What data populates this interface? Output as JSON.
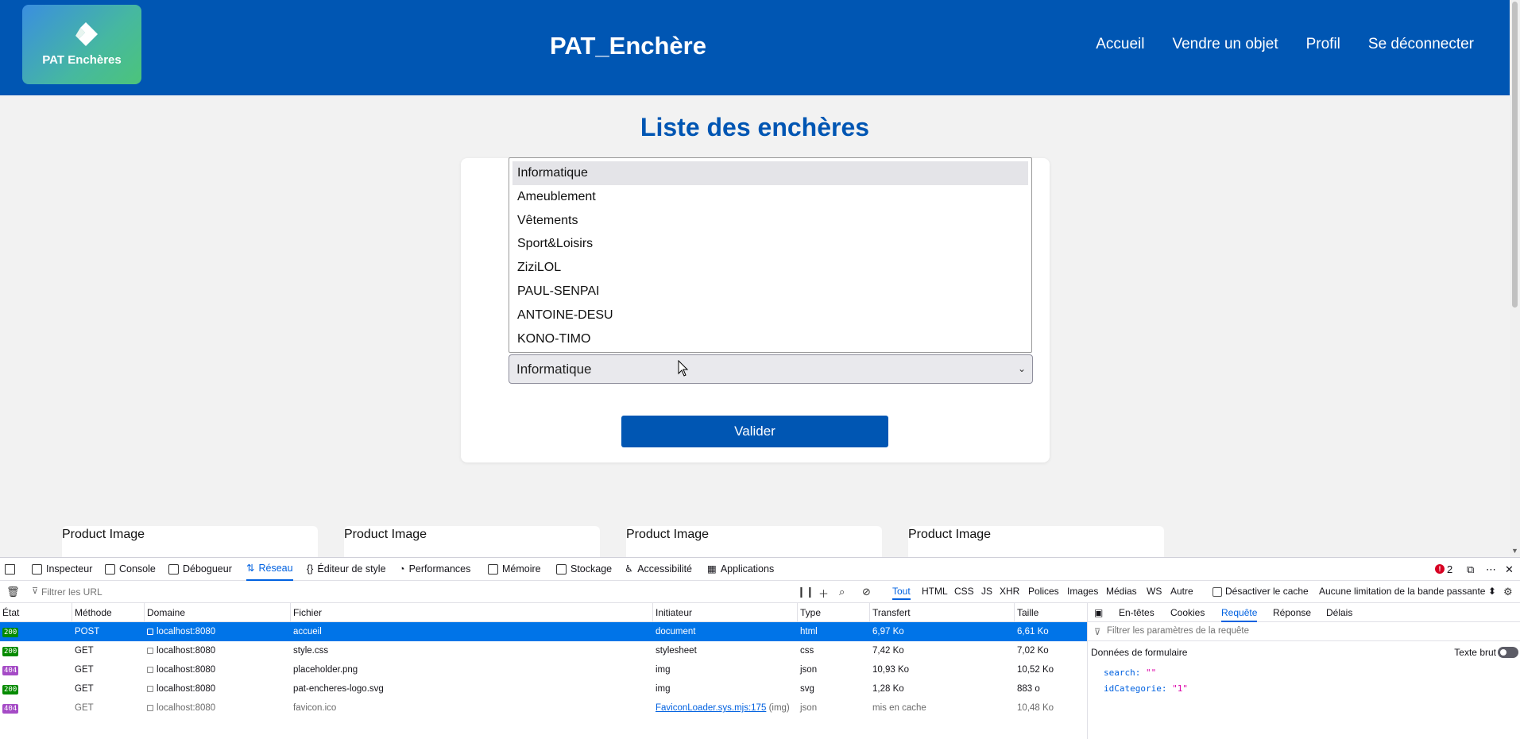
{
  "header": {
    "logo_text": "PAT Enchères",
    "title": "PAT_Enchère",
    "nav": [
      "Accueil",
      "Vendre un objet",
      "Profil",
      "Se déconnecter"
    ]
  },
  "main": {
    "heading": "Liste des enchères",
    "category_options": [
      "Informatique",
      "Ameublement",
      "Vêtements",
      "Sport&Loisirs",
      "ZiziLOL",
      "PAUL-SENPAI",
      "ANTOINE-DESU",
      "KONO-TIMO"
    ],
    "selected_category": "Informatique",
    "validate_label": "Valider",
    "product_cards": [
      "Product Image",
      "Product Image",
      "Product Image",
      "Product Image"
    ]
  },
  "devtools": {
    "tabs": [
      "Inspecteur",
      "Console",
      "Débogueur",
      "Réseau",
      "Éditeur de style",
      "Performances",
      "Mémoire",
      "Stockage",
      "Accessibilité",
      "Applications"
    ],
    "active_tab": "Réseau",
    "error_count": "2",
    "filter_placeholder": "Filtrer les URL",
    "type_filters": [
      "Tout",
      "HTML",
      "CSS",
      "JS",
      "XHR",
      "Polices",
      "Images",
      "Médias",
      "WS",
      "Autre"
    ],
    "disable_cache_label": "Désactiver le cache",
    "throttle_label": "Aucune limitation de la bande passante ⬍",
    "columns": [
      "État",
      "Méthode",
      "Domaine",
      "Fichier",
      "Initiateur",
      "Type",
      "Transfert",
      "Taille"
    ],
    "rows": [
      {
        "status": "200",
        "method": "POST",
        "domain": "localhost:8080",
        "file": "accueil",
        "initiator": "document",
        "initiator_extra": "",
        "type": "html",
        "transfer": "6,97 Ko",
        "size": "6,61 Ko"
      },
      {
        "status": "200",
        "method": "GET",
        "domain": "localhost:8080",
        "file": "style.css",
        "initiator": "stylesheet",
        "initiator_extra": "",
        "type": "css",
        "transfer": "7,42 Ko",
        "size": "7,02 Ko"
      },
      {
        "status": "404",
        "method": "GET",
        "domain": "localhost:8080",
        "file": "placeholder.png",
        "initiator": "img",
        "initiator_extra": "",
        "type": "json",
        "transfer": "10,93 Ko",
        "size": "10,52 Ko"
      },
      {
        "status": "200",
        "method": "GET",
        "domain": "localhost:8080",
        "file": "pat-encheres-logo.svg",
        "initiator": "img",
        "initiator_extra": "",
        "type": "svg",
        "transfer": "1,28 Ko",
        "size": "883 o"
      },
      {
        "status": "404",
        "method": "GET",
        "domain": "localhost:8080",
        "file": "favicon.ico",
        "initiator": "FaviconLoader.sys.mjs:175",
        "initiator_extra": "(img)",
        "type": "json",
        "transfer": "mis en cache",
        "size": "10,48 Ko"
      }
    ],
    "side_tabs": [
      "En-têtes",
      "Cookies",
      "Requête",
      "Réponse",
      "Délais"
    ],
    "active_side_tab": "Requête",
    "params_filter_placeholder": "Filtrer les paramètres de la requête",
    "form_data_title": "Données de formulaire",
    "raw_text_label": "Texte brut",
    "params": [
      {
        "key": "search:",
        "value": "\"\""
      },
      {
        "key": "idCategorie:",
        "value": "\"1\""
      }
    ],
    "colors": {
      "accent": "#0061e0",
      "ok": "#058b00",
      "not_found": "#a54bc6",
      "selected_row": "#0074e8"
    }
  }
}
